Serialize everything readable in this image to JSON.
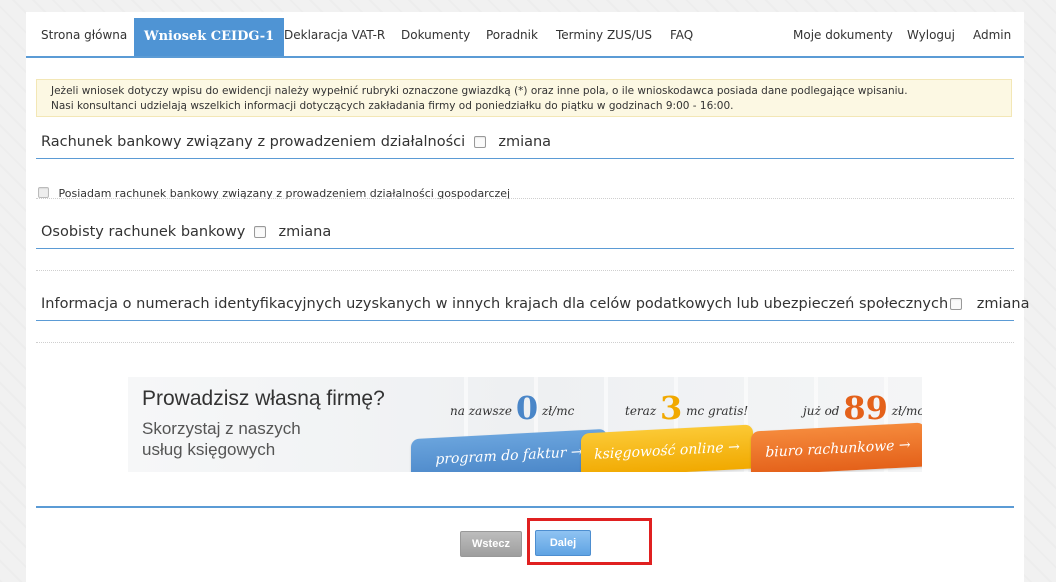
{
  "nav": {
    "items": [
      {
        "label": "Strona główna"
      },
      {
        "label": "Wniosek CEIDG-1"
      },
      {
        "label": "Deklaracja VAT-R"
      },
      {
        "label": "Dokumenty"
      },
      {
        "label": "Poradnik"
      },
      {
        "label": "Terminy ZUS/US"
      },
      {
        "label": "FAQ"
      }
    ],
    "right": [
      {
        "label": "Moje dokumenty"
      },
      {
        "label": "Wyloguj"
      },
      {
        "label": "Admin"
      }
    ]
  },
  "notice": {
    "line1": "Jeżeli wniosek dotyczy wpisu do ewidencji należy wypełnić rubryki oznaczone gwiazdką (*) oraz inne pola, o ile wnioskodawca posiada dane podlegające wpisaniu.",
    "line2": "Nasi konsultanci udzielają wszelkich informacji dotyczących zakładania firmy od poniedziałku do piątku w godzinach 9:00 - 16:00."
  },
  "sections": {
    "bank_account": {
      "title": "Rachunek bankowy związany z prowadzeniem działalności",
      "change": "zmiana"
    },
    "has_account_label": "Posiadam rachunek bankowy związany z prowadzeniem działalności gospodarczej",
    "personal_account": {
      "title": "Osobisty rachunek bankowy",
      "change": "zmiana"
    },
    "foreign_ids": {
      "title": "Informacja o numerach identyfikacyjnych uzyskanych w innych krajach dla celów podatkowych lub ubezpieczeń społecznych",
      "change": "zmiana"
    }
  },
  "banner": {
    "title": "Prowadzisz własną firmę?",
    "subtitle": "Skorzystaj z naszych usług księgowych",
    "offer1": {
      "prefix": "na zawsze",
      "num": "0",
      "suffix": "zł/mc",
      "tab": "program do faktur →"
    },
    "offer2": {
      "prefix": "teraz",
      "num": "3",
      "suffix": "mc gratis!",
      "tab": "księgowość online →"
    },
    "offer3": {
      "prefix": "już od",
      "num": "89",
      "suffix": "zł/mc",
      "tab": "biuro rachunkowe →"
    },
    "colors": {
      "blue": "#4a86c8",
      "yellow": "#f1a900",
      "orange": "#e4611a"
    }
  },
  "buttons": {
    "back": "Wstecz",
    "next": "Dalej"
  },
  "colors": {
    "accent": "#4f94d4",
    "highlight": "#e02020",
    "notice_bg": "#fcf8e3"
  }
}
